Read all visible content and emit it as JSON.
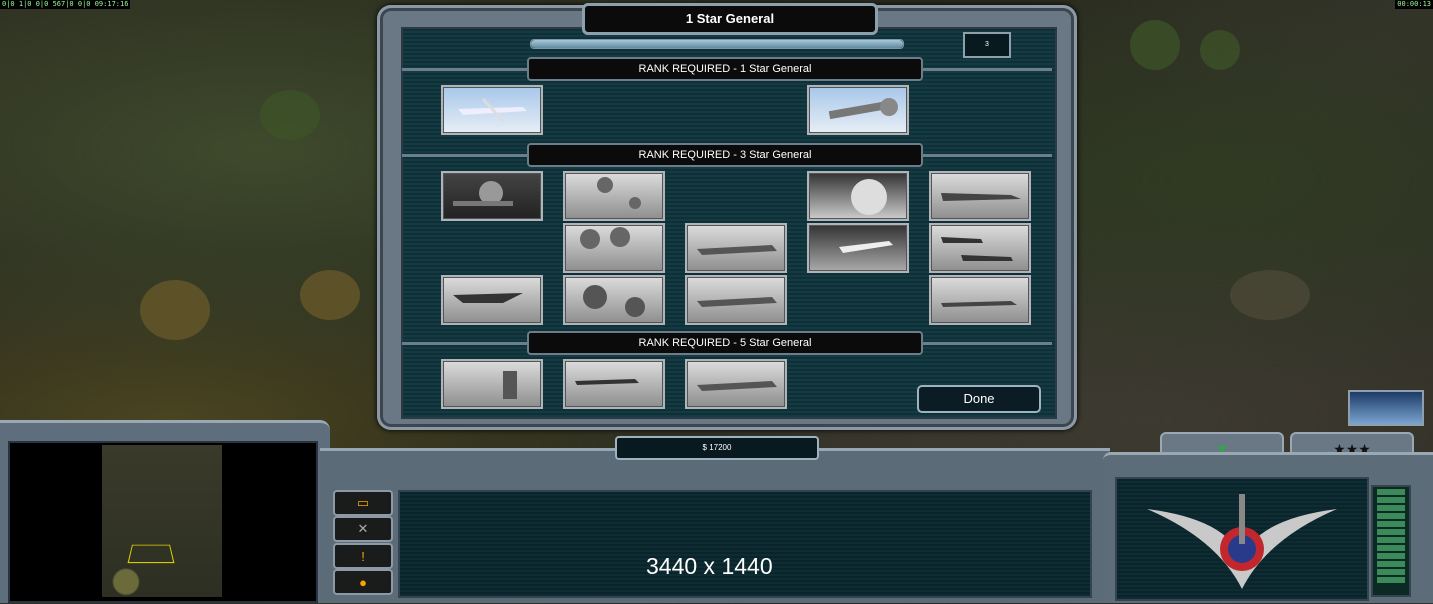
{
  "hud": {
    "left_debug": "0|0  1|0  0|0  567|0  0|0  09:17:16",
    "right_clock": "00:00:13"
  },
  "panel": {
    "title": "1 Star General",
    "points_value": "3",
    "rank_sections": [
      {
        "label": "RANK REQUIRED - 1 Star General"
      },
      {
        "label": "RANK REQUIRED - 3 Star General"
      },
      {
        "label": "RANK REQUIRED - 5 Star General"
      }
    ],
    "done_label": "Done"
  },
  "powers": [
    {
      "rank": 1,
      "icon": "predator-drone-icon",
      "color": true
    },
    {
      "rank": 1,
      "icon": "wrench-repair-icon",
      "color": true
    },
    {
      "rank": 3,
      "icon": "camo-soldier-icon"
    },
    {
      "rank": 3,
      "icon": "paradrop-1-icon"
    },
    {
      "rank": 3,
      "icon": "paradrop-2-icon"
    },
    {
      "rank": 3,
      "icon": "bomber-1-icon"
    },
    {
      "rank": 3,
      "icon": "stealth-bomber-icon"
    },
    {
      "rank": 3,
      "icon": "paradrop-3-icon"
    },
    {
      "rank": 3,
      "icon": "bomber-2-icon"
    },
    {
      "rank": 3,
      "icon": "explosion-icon"
    },
    {
      "rank": 3,
      "icon": "fighter-jet-icon"
    },
    {
      "rank": 3,
      "icon": "a10-strike-1-icon"
    },
    {
      "rank": 3,
      "icon": "a10-strike-2-icon"
    },
    {
      "rank": 3,
      "icon": "a10-strike-3-icon"
    },
    {
      "rank": 5,
      "icon": "supply-drop-icon"
    },
    {
      "rank": 5,
      "icon": "carpet-bomb-icon"
    },
    {
      "rank": 5,
      "icon": "bomber-3-icon"
    }
  ],
  "money": "$ 17200",
  "resolution_text": "3440 x 1440",
  "colors": {
    "accent": "#9fb2c0",
    "panel": "#143a42"
  }
}
